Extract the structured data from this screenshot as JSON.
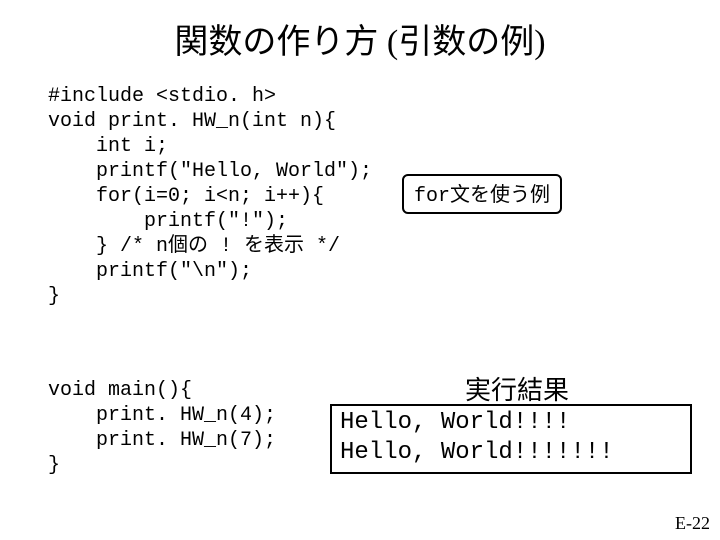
{
  "title": "関数の作り方 (引数の例)",
  "code_block_1": "#include <stdio. h>\nvoid print. HW_n(int n){\n    int i;\n    printf(\"Hello, World\");\n    for(i=0; i<n; i++){\n        printf(\"!\");\n    } /* n個の ! を表示 */\n    printf(\"\\n\");\n}",
  "code_block_2": "void main(){\n    print. HW_n(4);\n    print. HW_n(7);\n}",
  "note_box": "for文を使う例",
  "result_label": "実行結果",
  "result_lines": "Hello, World!!!!\nHello, World!!!!!!!",
  "page_number": "E-22"
}
